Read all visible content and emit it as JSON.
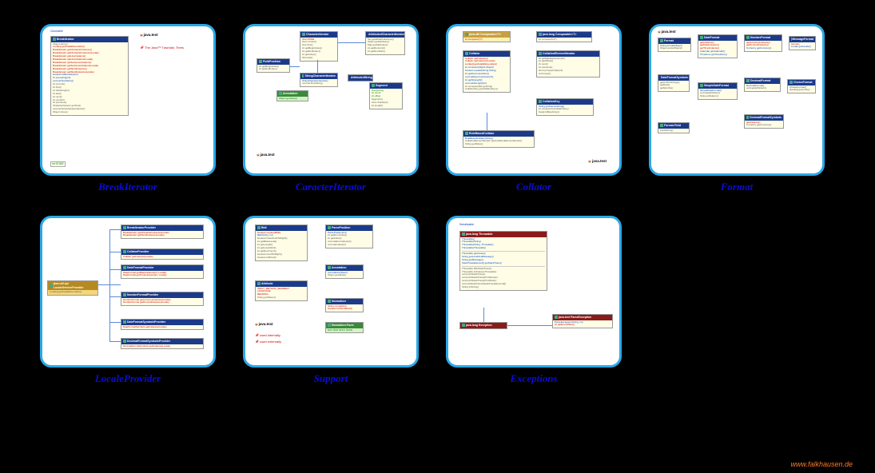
{
  "footer": "www.falkhausen.de",
  "cards": [
    {
      "title": "BreakIterator"
    },
    {
      "title": "CaracterIterator"
    },
    {
      "title": "Collator"
    },
    {
      "title": "Format"
    },
    {
      "title": "LocaleProvider"
    },
    {
      "title": "Support"
    },
    {
      "title": "Exceptions"
    }
  ],
  "pkg_label": "java.text",
  "breakiterator": {
    "cloneable": "Cloneable",
    "class": "BreakIterator",
    "legend": "The Java™ Tutorials: Trees",
    "done": "int DONE",
    "methods_red": [
      "Locale[] getAvailableLocales()",
      "BreakIterator getCharacterInstance()",
      "BreakIterator getCharacterInstance(Locale)",
      "BreakIterator getLineInstance()",
      "BreakIterator getLineInstance(Locale)",
      "BreakIterator getSentenceInstance()",
      "BreakIterator getSentenceInstance(Locale)",
      "BreakIterator getWordInstance()",
      "BreakIterator getWordInstance(Locale)"
    ],
    "methods_blue": [
      "boolean isBoundary(int)",
      "int preceding(int)",
      "void setText(String)"
    ],
    "methods_plain": [
      "int current()",
      "int first()",
      "int following(int)",
      "int last()",
      "int next()",
      "int next(int)",
      "int previous()",
      "CharacterIterator getText()",
      "void setText(CharacterIterator)"
    ],
    "methods_clone": "Object clone()"
  },
  "chariter": {
    "classes": [
      "CharacterIterator",
      "StringCharacterIterator",
      "AttributedCharacterIterator",
      "AttributedString",
      "FieldPosition"
    ],
    "annot": "Annotation"
  },
  "collator": {
    "classes": [
      "Collator",
      "RuleBasedCollator",
      "CollationElementIterator",
      "CollationKey"
    ]
  },
  "format": {
    "classes": [
      "Format",
      "DateFormat",
      "SimpleDateFormat",
      "NumberFormat",
      "DecimalFormat",
      "ChoiceFormat",
      "MessageFormat",
      "DateFormatSymbols",
      "DecimalFormatSymbols"
    ]
  },
  "localeprovider": {
    "root": "java.util.spi LocaleServiceProvider",
    "root_method": "Locale[] getAvailableLocales()",
    "classes": [
      "BreakIteratorProvider",
      "CollatorProvider",
      "DateFormatProvider",
      "NumberFormatProvider",
      "DateFormatSymbolsProvider",
      "DecimalFormatSymbolsProvider"
    ]
  },
  "support": {
    "classes": [
      "Bidi",
      "Normalizer",
      "ParsePosition",
      "Annotation"
    ],
    "enum": "Normalizer.Form",
    "legend": [
      "used internally",
      "used externally"
    ]
  },
  "exceptions": {
    "serializable": "Serializable",
    "throwable": "java.lang Throwable",
    "exception": "java.lang Exception",
    "parse": "java.text ParseException",
    "throwable_methods": [
      "Throwable()",
      "Throwable(String)",
      "Throwable(String, Throwable)",
      "Throwable(Throwable)"
    ],
    "throwable_get": [
      "Throwable getCause()",
      "String getLocalizedMessage()",
      "String getMessage()",
      "StackTraceElement[] getStackTrace()"
    ],
    "throwable_misc": [
      "Throwable fillInStackTrace()",
      "Throwable initCause(Throwable)",
      "void printStackTrace()",
      "void printStackTrace(PrintStream)",
      "void printStackTrace(PrintWriter)",
      "void setStackTrace(StackTraceElement[])",
      "String toString()"
    ],
    "parse_ctor": "ParseException(String, int)",
    "parse_m": "int getErrorOffset()"
  }
}
